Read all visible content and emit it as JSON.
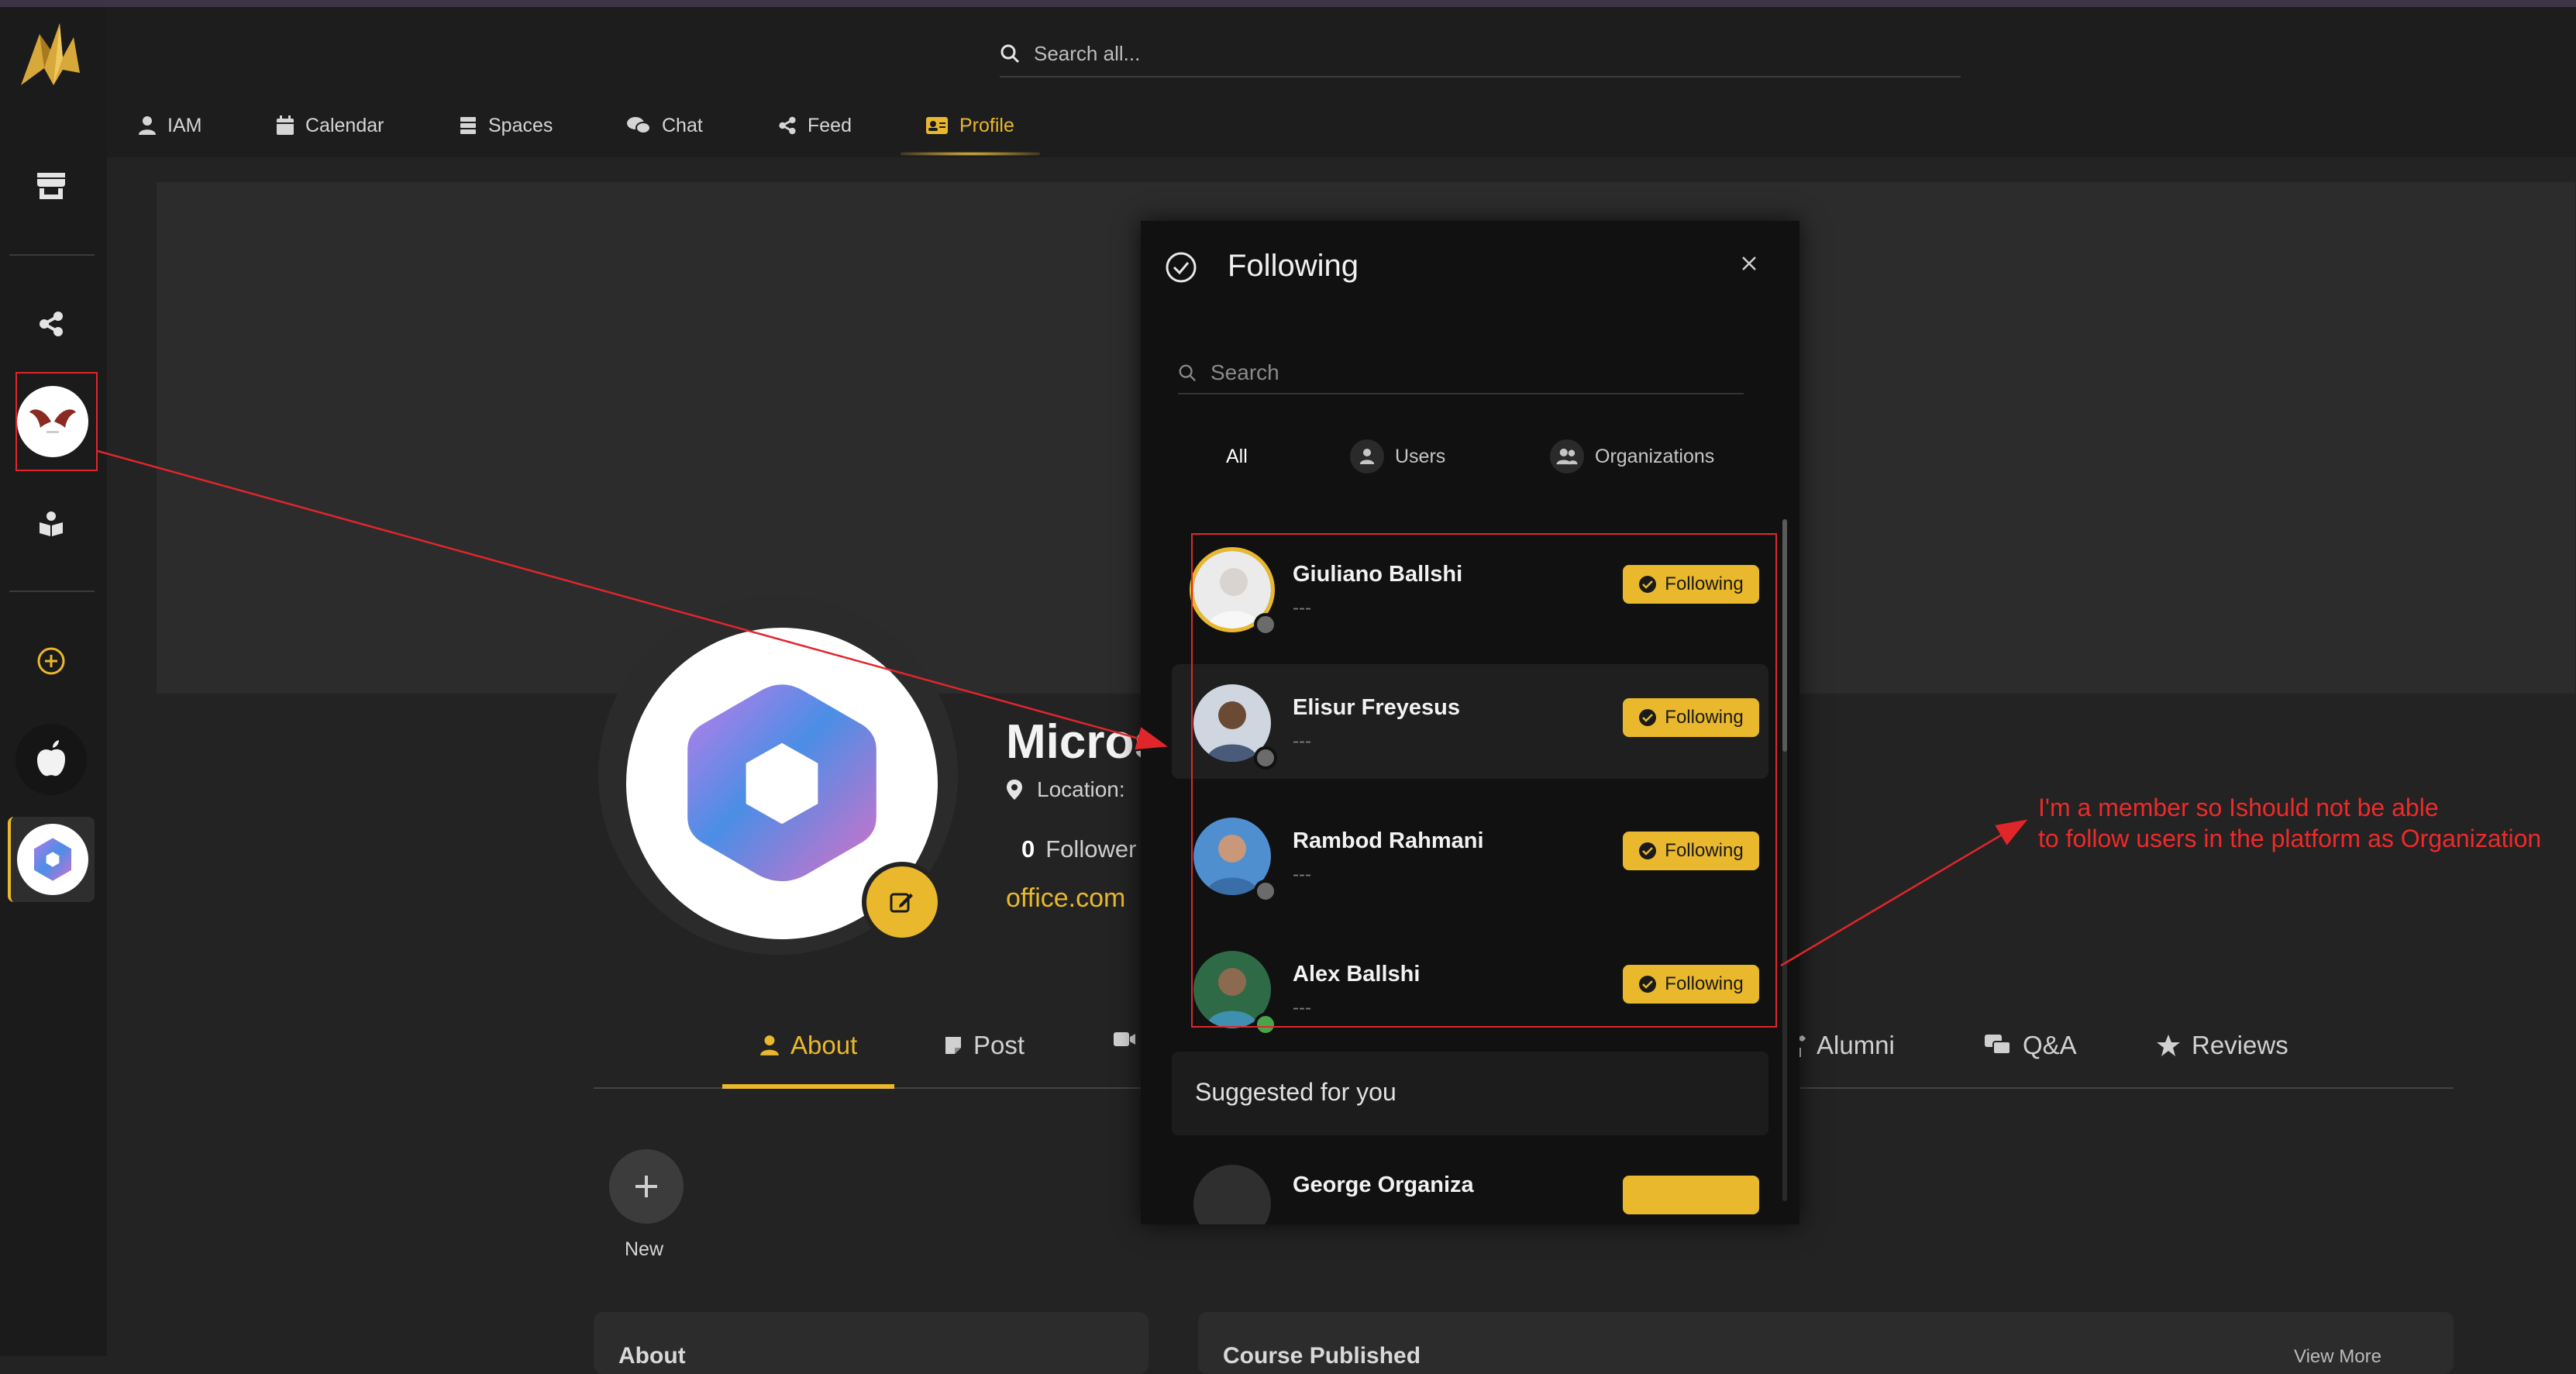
{
  "search": {
    "placeholder": "Search all..."
  },
  "nav": {
    "tabs": [
      {
        "label": "IAM",
        "icon": "user-icon"
      },
      {
        "label": "Calendar",
        "icon": "calendar-icon"
      },
      {
        "label": "Spaces",
        "icon": "stack-icon"
      },
      {
        "label": "Chat",
        "icon": "chat-icon"
      },
      {
        "label": "Feed",
        "icon": "share-icon"
      },
      {
        "label": "Profile",
        "icon": "id-card-icon",
        "active": true
      }
    ]
  },
  "profile": {
    "name": "Micros",
    "location_label": "Location:",
    "followers_count": "0",
    "followers_label": "Follower",
    "website": "office.com",
    "tabs": [
      {
        "label": "About",
        "icon": "user-icon",
        "active": true
      },
      {
        "label": "Post",
        "icon": "note-icon"
      },
      {
        "label": "Alumni",
        "icon": "graduate-icon"
      },
      {
        "label": "Q&A",
        "icon": "qa-icon"
      },
      {
        "label": "Reviews",
        "icon": "star-icon"
      }
    ],
    "new_label": "New",
    "cards": {
      "about": "About",
      "course": "Course Published",
      "view_more": "View More"
    }
  },
  "modal": {
    "title": "Following",
    "search_placeholder": "Search",
    "tabs": [
      {
        "label": "All",
        "active": true
      },
      {
        "label": "Users",
        "icon": "user-icon"
      },
      {
        "label": "Organizations",
        "icon": "users-icon"
      }
    ],
    "items": [
      {
        "name": "Giuliano Ballshi",
        "subtitle": "---",
        "button": "Following",
        "status": "offline",
        "skin": "#d9d4cf",
        "shirt": "#f4f4f4"
      },
      {
        "name": "Elisur Freyesus",
        "subtitle": "---",
        "button": "Following",
        "status": "offline",
        "skin": "#6b4a35",
        "shirt": "#4a5a7a"
      },
      {
        "name": "Rambod Rahmani",
        "subtitle": "---",
        "button": "Following",
        "status": "offline",
        "skin": "#c9977a",
        "shirt": "#3a6ea8"
      },
      {
        "name": "Alex Ballshi",
        "subtitle": "---",
        "button": "Following",
        "status": "online",
        "skin": "#8b6a50",
        "shirt": "#2b5a3a"
      }
    ],
    "suggested_label": "Suggested for you",
    "suggested_partial_name": "George Organiza"
  },
  "annotation": {
    "line1": "I'm a member so Ishould not be able",
    "line2": "to follow users in the platform as Organization"
  },
  "colors": {
    "accent": "#e9b82c",
    "annotation": "#e0262b",
    "modal_bg": "#111111"
  }
}
